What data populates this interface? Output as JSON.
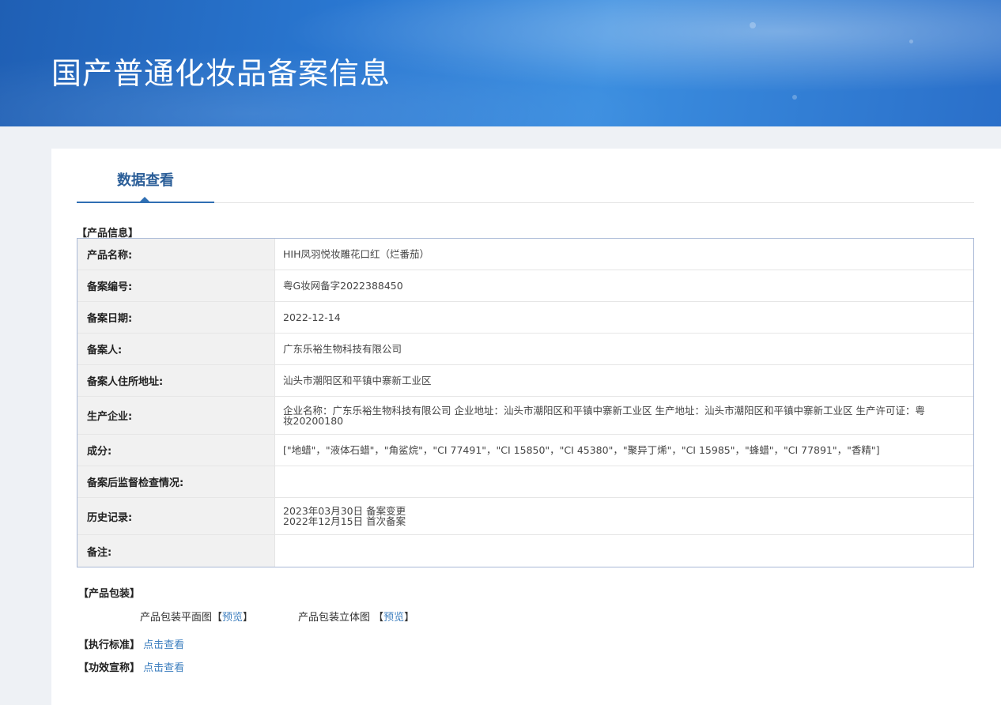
{
  "header": {
    "title": "国产普通化妆品备案信息"
  },
  "tabs": [
    {
      "label": "数据查看"
    }
  ],
  "product_info": {
    "section_label": "【产品信息】",
    "rows": [
      {
        "label": "产品名称:",
        "value": "HIH凤羽悦妆雕花口红（烂番茄）"
      },
      {
        "label": "备案编号:",
        "value": "粤G妆网备字2022388450"
      },
      {
        "label": "备案日期:",
        "value": "2022-12-14"
      },
      {
        "label": "备案人:",
        "value": "广东乐裕生物科技有限公司"
      },
      {
        "label": "备案人住所地址:",
        "value": "汕头市潮阳区和平镇中寨新工业区"
      },
      {
        "label": "生产企业:",
        "value": "企业名称：广东乐裕生物科技有限公司 企业地址：汕头市潮阳区和平镇中寨新工业区 生产地址：汕头市潮阳区和平镇中寨新工业区 生产许可证：粤妆20200180"
      },
      {
        "label": "成分:",
        "value": "[\"地蜡\"，\"液体石蜡\"，\"角鲨烷\"，\"CI 77491\"，\"CI 15850\"，\"CI 45380\"，\"聚异丁烯\"，\"CI 15985\"，\"蜂蜡\"，\"CI 77891\"，\"香精\"]"
      },
      {
        "label": "备案后监督检查情况:",
        "value": ""
      },
      {
        "label": "历史记录:",
        "lines": [
          "2023年03月30日 备案变更",
          "2022年12月15日 首次备案"
        ]
      },
      {
        "label": "备注:",
        "value": ""
      }
    ]
  },
  "packaging": {
    "section_label": "【产品包装】",
    "flat_label": "产品包装平面图【",
    "flat_link": "预览",
    "flat_close": "】",
    "stereo_label": "产品包装立体图 【",
    "stereo_link": "预览",
    "stereo_close": "】"
  },
  "standard": {
    "label": "【执行标准】",
    "link": "点击查看"
  },
  "efficacy": {
    "label": "【功效宣称】",
    "link": "点击查看"
  }
}
